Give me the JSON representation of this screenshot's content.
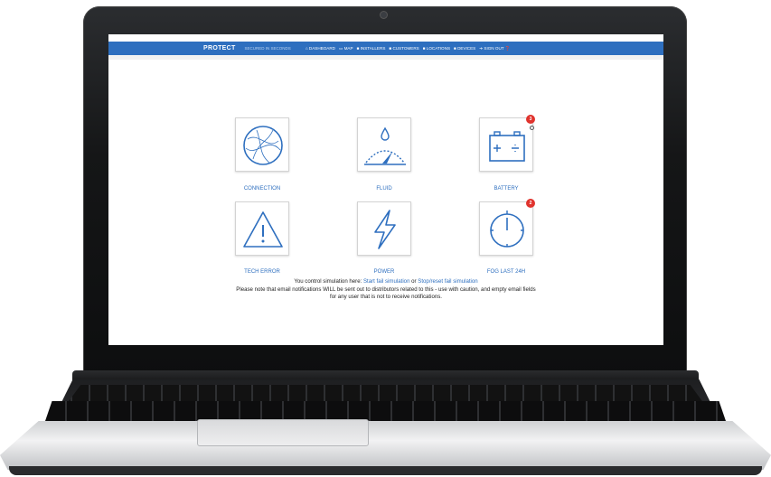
{
  "topbar": {
    "brand": "PROTECT",
    "tagline": "SECURED IN SECONDS",
    "nav": [
      "DASHBOARD",
      "MAP",
      "INSTALLERS",
      "CUSTOMERS",
      "LOCATIONS",
      "DEVICES",
      "SIGN OUT"
    ]
  },
  "tiles": [
    {
      "label": "CONNECTION",
      "icon": "globe-icon"
    },
    {
      "label": "FLUID",
      "icon": "gauge-drop-icon"
    },
    {
      "label": "BATTERY",
      "icon": "battery-icon",
      "badge": "3"
    },
    {
      "label": "TECH ERROR",
      "icon": "warning-icon"
    },
    {
      "label": "POWER",
      "icon": "lightning-icon"
    },
    {
      "label": "FOG LAST 24H",
      "icon": "clock-icon",
      "badge": "2"
    }
  ],
  "notes": {
    "line1_prefix": "You control simulation here: ",
    "start_link": "Start fail simulation",
    "or": " or ",
    "stop_link": "Stop/reset fail simulation",
    "line2": "Please note that email notifications WILL be sent out to distributors related to this - use with caution, and empty email fields",
    "line3": "for any user that is not to receive notifications."
  },
  "colors": {
    "accent": "#2e6fbf",
    "badge": "#e0332d"
  }
}
